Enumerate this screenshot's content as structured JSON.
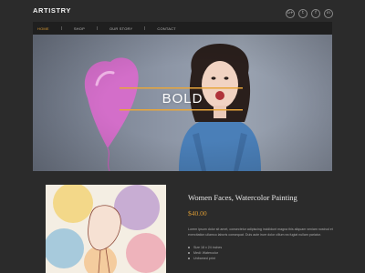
{
  "header": {
    "logo": "ARTISTRY",
    "social": [
      {
        "icon": "google-plus-icon",
        "glyph": "G+"
      },
      {
        "icon": "twitter-icon",
        "glyph": "t"
      },
      {
        "icon": "facebook-icon",
        "glyph": "f"
      },
      {
        "icon": "linkedin-icon",
        "glyph": "in"
      }
    ]
  },
  "nav": {
    "items": [
      {
        "label": "HOME",
        "active": true
      },
      {
        "label": "SHOP",
        "active": false
      },
      {
        "label": "OUR STORY",
        "active": false
      },
      {
        "label": "CONTACT",
        "active": false
      }
    ]
  },
  "hero": {
    "title": "BOLD"
  },
  "product": {
    "title": "Women Faces, Watercolor Painting",
    "price": "$40.00",
    "description": "Lorem ipsum dolor sit amet, consectetur adipiscing incididunt magna this aliquam veniam nostrud et exercitation ullamco laboris consequat. Duis aute irure dolor cillum ea fugiat nullam pariatur.",
    "features": [
      "Size 18 x 24 inches",
      "Medi: Watercolor",
      "Unframed print"
    ]
  },
  "colors": {
    "accent": "#d89a34",
    "background": "#2b2b2b",
    "nav_background": "#1f1f1f",
    "hero_stripe": "#e8a63a"
  }
}
